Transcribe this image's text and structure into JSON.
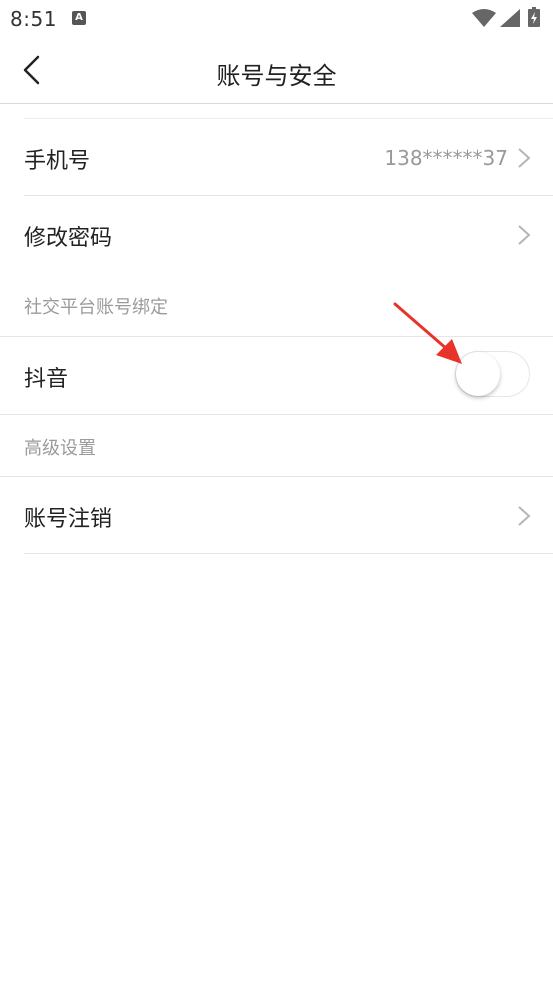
{
  "status_bar": {
    "time": "8:51",
    "notification_icon": "android-a-icon",
    "wifi_icon": "wifi-icon",
    "signal_icon": "cell-signal-icon",
    "battery_icon": "battery-icon"
  },
  "header": {
    "title": "账号与安全",
    "back_icon": "chevron-left-icon"
  },
  "rows": {
    "phone": {
      "label": "手机号",
      "value": "138******37"
    },
    "password": {
      "label": "修改密码"
    },
    "douyin": {
      "label": "抖音",
      "toggle_on": false
    },
    "delete_account": {
      "label": "账号注销"
    }
  },
  "sections": {
    "social_binding": "社交平台账号绑定",
    "advanced": "高级设置"
  },
  "colors": {
    "annotation_arrow": "#e8332b",
    "divider": "#e5e5e5",
    "secondary_text": "#9b9b9b"
  }
}
